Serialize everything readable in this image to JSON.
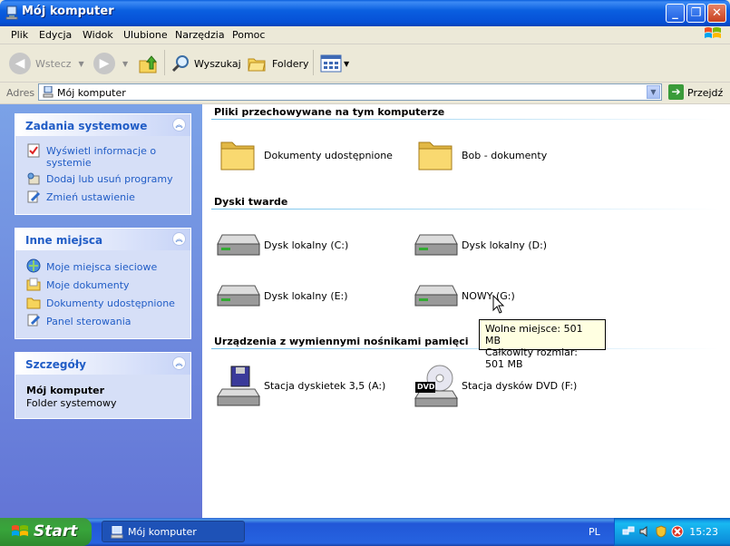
{
  "window": {
    "title": "Mój komputer"
  },
  "menu": [
    "Plik",
    "Edycja",
    "Widok",
    "Ulubione",
    "Narzędzia",
    "Pomoc"
  ],
  "toolbar": {
    "back_label": "Wstecz",
    "search_label": "Wyszukaj",
    "folders_label": "Foldery"
  },
  "address": {
    "label": "Adres",
    "value": "Mój komputer",
    "go_label": "Przejdź"
  },
  "left": {
    "system_tasks": {
      "title": "Zadania systemowe",
      "items": [
        "Wyświetl informacje o systemie",
        "Dodaj lub usuń programy",
        "Zmień ustawienie"
      ]
    },
    "other_places": {
      "title": "Inne miejsca",
      "items": [
        "Moje miejsca sieciowe",
        "Moje dokumenty",
        "Dokumenty udostępnione",
        "Panel sterowania"
      ]
    },
    "details": {
      "title": "Szczegóły",
      "name": "Mój komputer",
      "type": "Folder systemowy"
    }
  },
  "main": {
    "sections": [
      {
        "title": "Pliki przechowywane na tym komputerze",
        "items": [
          "Dokumenty udostępnione",
          "Bob - dokumenty"
        ]
      },
      {
        "title": "Dyski twarde",
        "items": [
          "Dysk lokalny (C:)",
          "Dysk lokalny (D:)",
          "Dysk lokalny (E:)",
          "NOWY (G:)"
        ]
      },
      {
        "title": "Urządzenia z wymiennymi nośnikami pamięci",
        "items": [
          "Stacja dyskietek 3,5 (A:)",
          "Stacja dysków DVD (F:)"
        ]
      }
    ],
    "tooltip": {
      "line1": "Wolne miejsce: 501 MB",
      "line2": "Całkowity rozmiar: 501 MB"
    },
    "dvd_badge": "DVD"
  },
  "taskbar": {
    "start_label": "Start",
    "task_label": "Mój komputer",
    "lang": "PL",
    "clock": "15:23"
  }
}
